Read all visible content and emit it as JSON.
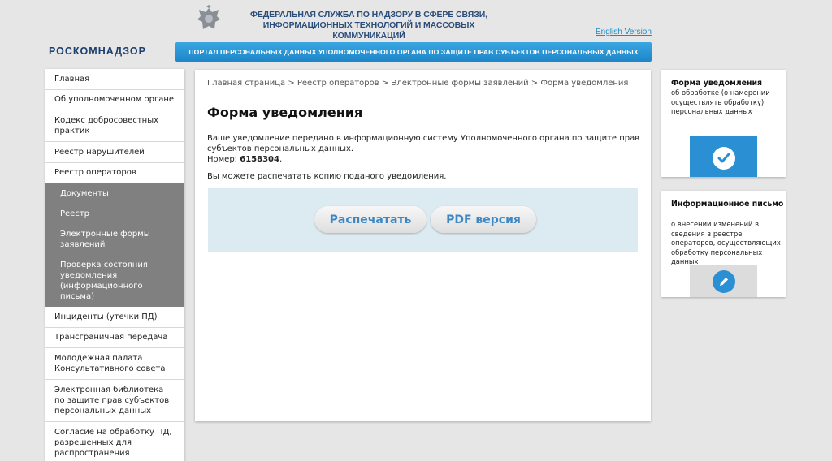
{
  "header": {
    "agency_title": "ФЕДЕРАЛЬНАЯ СЛУЖБА ПО НАДЗОРУ В СФЕРЕ СВЯЗИ, ИНФОРМАЦИОННЫХ ТЕХНОЛОГИЙ И МАССОВЫХ КОММУНИКАЦИЙ",
    "english_link": "English Version",
    "logo_text": "РОСКОМНАДЗОР",
    "portal_banner": "ПОРТАЛ ПЕРСОНАЛЬНЫХ ДАННЫХ УПОЛНОМОЧЕННОГО ОРГАНА ПО ЗАЩИТЕ ПРАВ СУБЪЕКТОВ ПЕРСОНАЛЬНЫХ ДАННЫХ",
    "emblem_icon": "eagle-emblem-icon"
  },
  "sidebar": {
    "items": [
      {
        "label": "Главная"
      },
      {
        "label": "Об уполномоченном органе"
      },
      {
        "label": "Кодекс добросовестных практик"
      },
      {
        "label": "Реестр нарушителей"
      },
      {
        "label": "Реестр операторов"
      }
    ],
    "subitems": [
      {
        "label": "Документы"
      },
      {
        "label": "Реестр"
      },
      {
        "label": "Электронные формы заявлений"
      },
      {
        "label": "Проверка состояния уведомления (информационного письма)"
      }
    ],
    "items_after": [
      {
        "label": "Инциденты (утечки ПД)"
      },
      {
        "label": "Трансграничная передача"
      },
      {
        "label": "Молодежная палата Консультативного совета"
      },
      {
        "label": "Электронная библиотека по защите прав субъектов персональных данных"
      },
      {
        "label": "Согласие на обработку ПД, разрешенных для распространения"
      }
    ]
  },
  "main": {
    "breadcrumb": "Главная страница > Реестр операторов > Электронные формы заявлений > Форма уведомления",
    "title": "Форма уведомления",
    "message": "Ваше уведомление передано в информационную систему Уполномоченного органа по защите прав субъектов персональных данных.",
    "number_label": "Номер:",
    "number_value": "6158304",
    "number_suffix": ",",
    "print_hint": "Вы можете распечатать копию поданого уведомления.",
    "print_button": "Распечатать",
    "pdf_button": "PDF версия"
  },
  "cards": [
    {
      "title": "Форма уведомления",
      "description": "об обработке (о намерении осуществлять обработку) персональных данных",
      "icon": "checkmark-icon",
      "accent": "#2b8fd3"
    },
    {
      "title": "Информационное письмо",
      "description": "о внесении изменений в сведения в реестре операторов, осуществляющих обработку персональных данных",
      "icon": "pencil-icon",
      "accent": "#2b8fd3"
    }
  ],
  "colors": {
    "banner": "#2a93d5",
    "sub_nav_bg": "#808080",
    "action_box": "#dceaf2",
    "button_text": "#3d88c4"
  }
}
